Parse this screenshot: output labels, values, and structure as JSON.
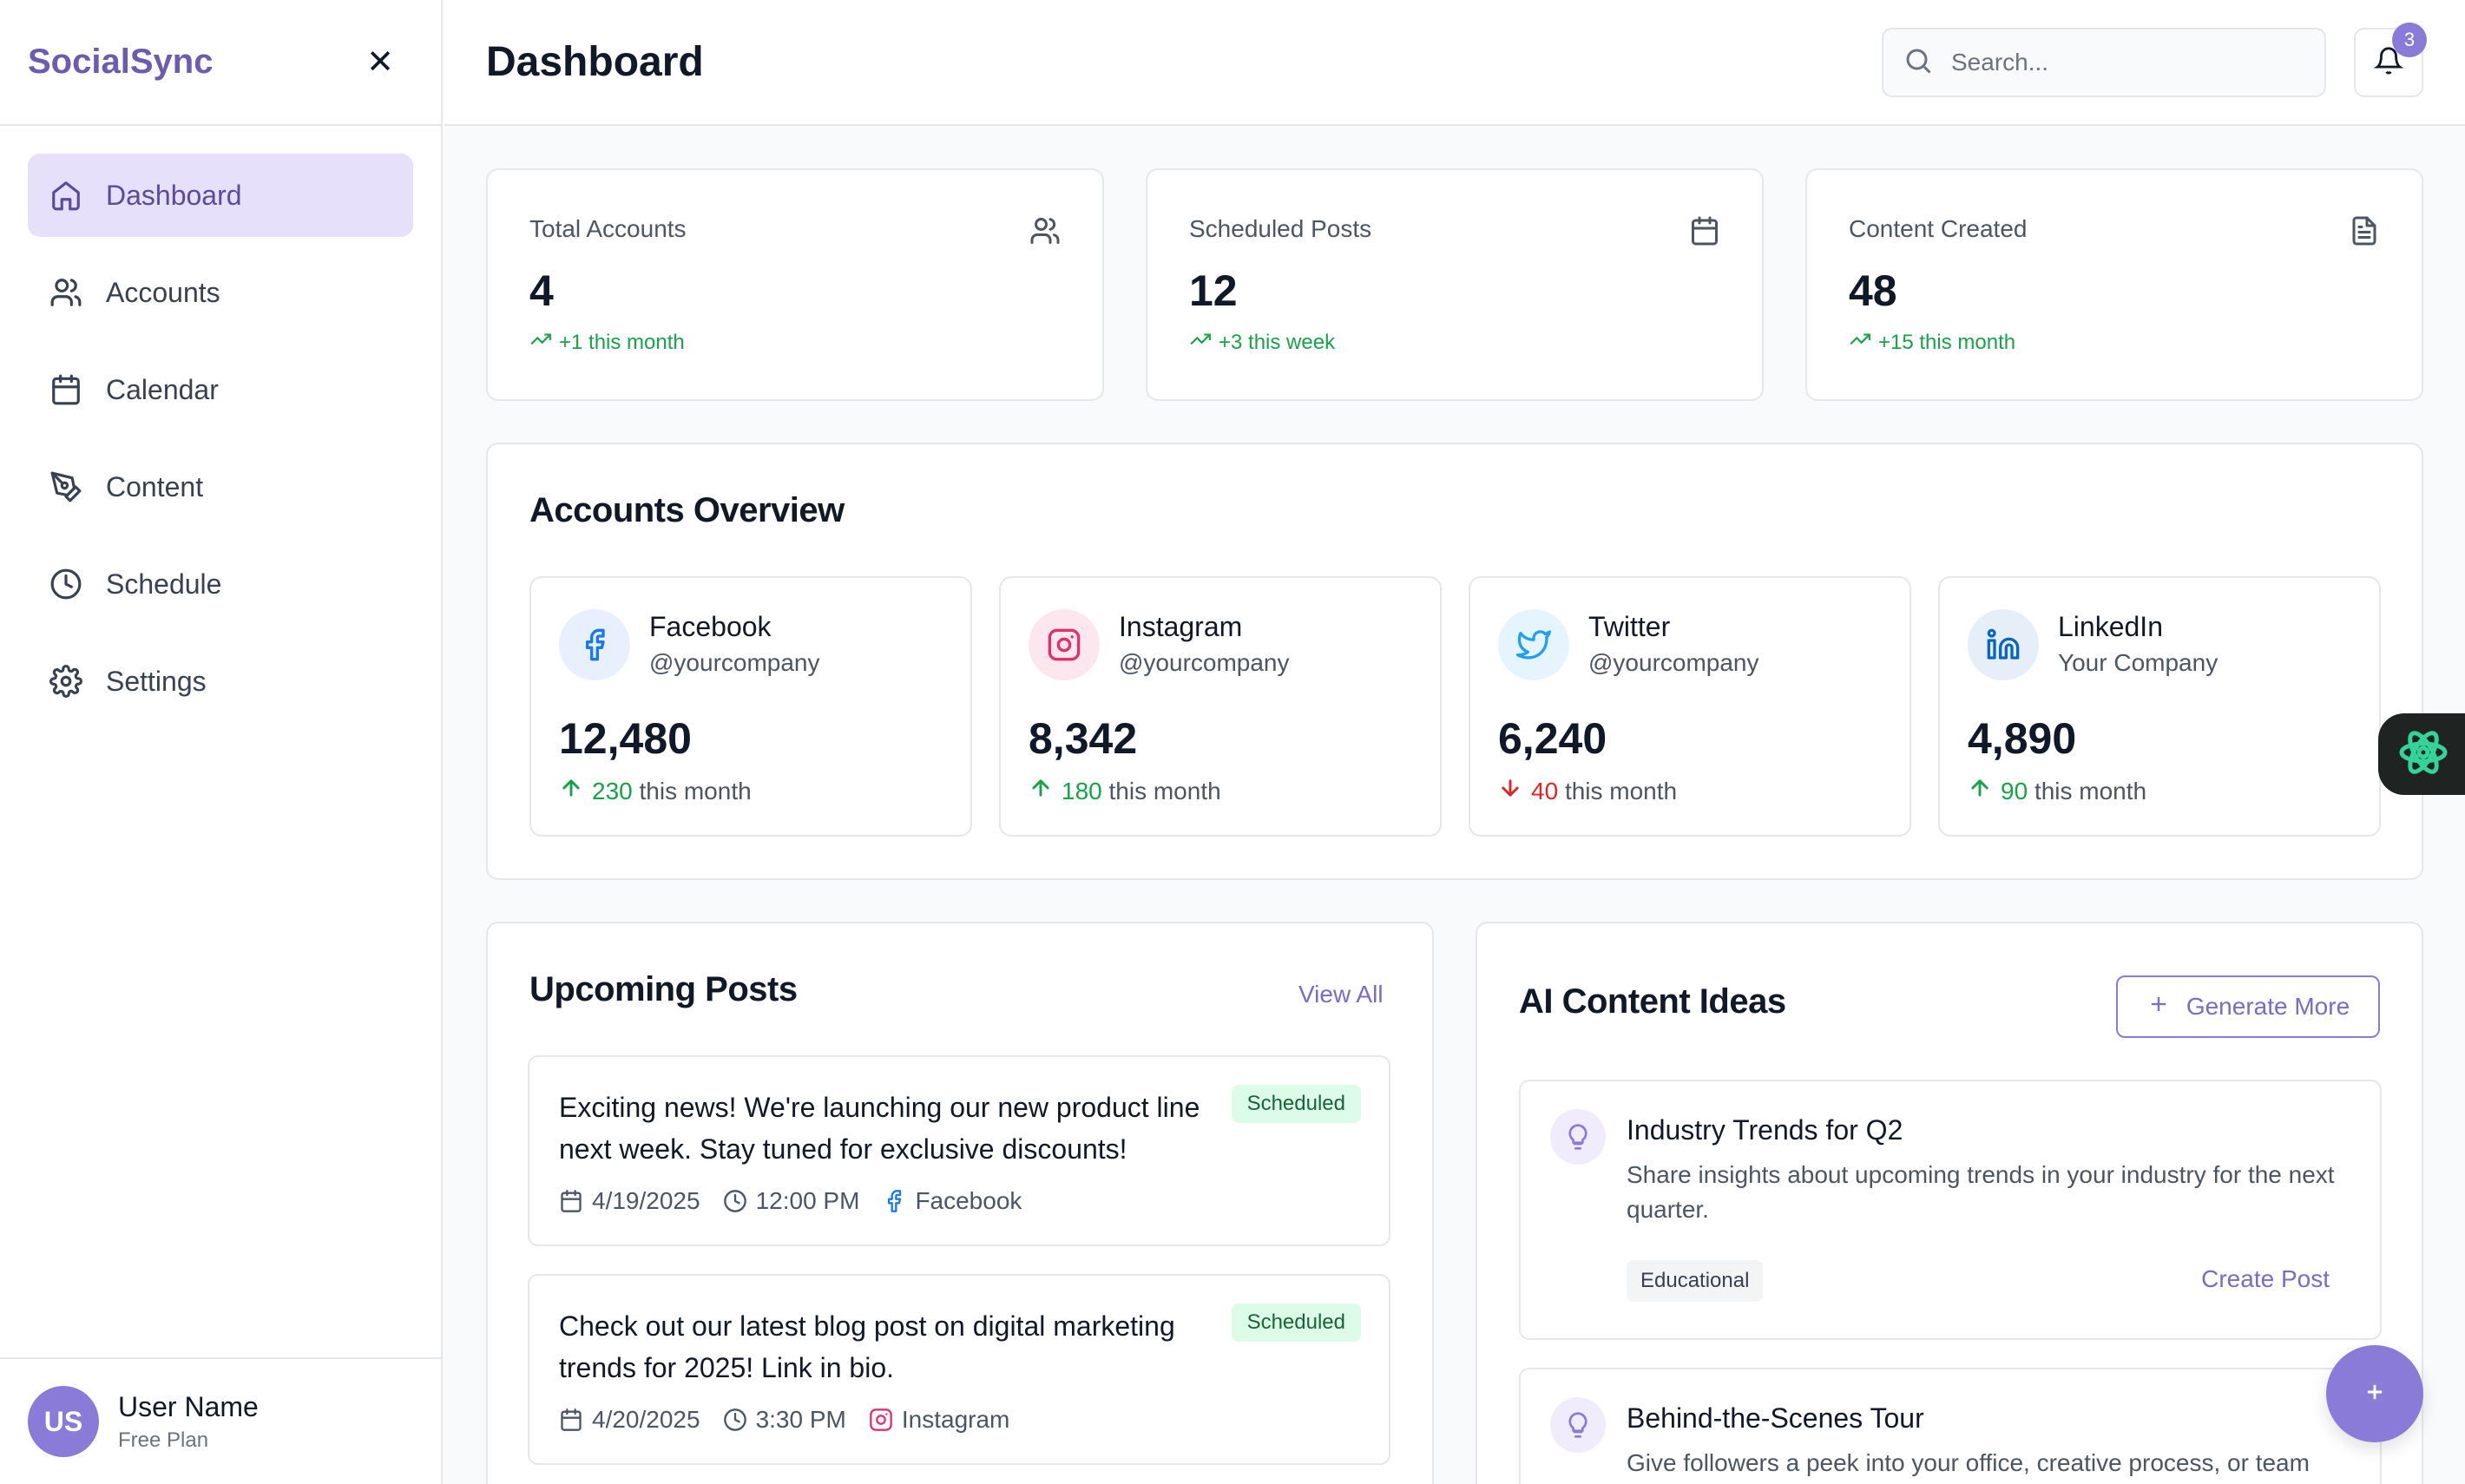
{
  "sidebar": {
    "brand": "SocialSync",
    "items": [
      {
        "label": "Dashboard",
        "icon": "home-icon"
      },
      {
        "label": "Accounts",
        "icon": "users-icon"
      },
      {
        "label": "Calendar",
        "icon": "calendar-icon"
      },
      {
        "label": "Content",
        "icon": "pen-tool-icon"
      },
      {
        "label": "Schedule",
        "icon": "clock-icon"
      },
      {
        "label": "Settings",
        "icon": "gear-icon"
      }
    ],
    "user": {
      "initials": "US",
      "name": "User Name",
      "plan": "Free Plan"
    }
  },
  "header": {
    "title": "Dashboard",
    "search_placeholder": "Search...",
    "notification_count": "3"
  },
  "stats": [
    {
      "label": "Total Accounts",
      "value": "4",
      "trend": "+1 this month",
      "icon": "users-icon"
    },
    {
      "label": "Scheduled Posts",
      "value": "12",
      "trend": "+3 this week",
      "icon": "calendar-icon"
    },
    {
      "label": "Content Created",
      "value": "48",
      "trend": "+15 this month",
      "icon": "document-icon"
    }
  ],
  "accounts_overview": {
    "title": "Accounts Overview",
    "accounts": [
      {
        "name": "Facebook",
        "handle": "@yourcompany",
        "count": "12,480",
        "change": "230",
        "suffix": "this month",
        "direction": "up"
      },
      {
        "name": "Instagram",
        "handle": "@yourcompany",
        "count": "8,342",
        "change": "180",
        "suffix": "this month",
        "direction": "up"
      },
      {
        "name": "Twitter",
        "handle": "@yourcompany",
        "count": "6,240",
        "change": "40",
        "suffix": "this month",
        "direction": "down"
      },
      {
        "name": "LinkedIn",
        "handle": "Your Company",
        "count": "4,890",
        "change": "90",
        "suffix": "this month",
        "direction": "up"
      }
    ]
  },
  "upcoming_posts": {
    "title": "Upcoming Posts",
    "view_all": "View All",
    "posts": [
      {
        "text": "Exciting news! We're launching our new product line next week. Stay tuned for exclusive discounts!",
        "status": "Scheduled",
        "date": "4/19/2025",
        "time": "12:00 PM",
        "platform": "Facebook"
      },
      {
        "text": "Check out our latest blog post on digital marketing trends for 2025! Link in bio.",
        "status": "Scheduled",
        "date": "4/20/2025",
        "time": "3:30 PM",
        "platform": "Instagram"
      }
    ]
  },
  "ai_ideas": {
    "title": "AI Content Ideas",
    "generate_label": "Generate More",
    "ideas": [
      {
        "title": "Industry Trends for Q2",
        "description": "Share insights about upcoming trends in your industry for the next quarter.",
        "tag": "Educational",
        "action": "Create Post"
      },
      {
        "title": "Behind-the-Scenes Tour",
        "description": "Give followers a peek into your office, creative process, or team"
      }
    ]
  },
  "colors": {
    "accent": "#8b7bd8",
    "accent_light": "#e6e0fa",
    "positive": "#16a34a",
    "negative": "#dc2626",
    "facebook": "#1877f2",
    "instagram": "#e1306c",
    "twitter": "#1da1f2",
    "linkedin": "#0a66c2"
  }
}
